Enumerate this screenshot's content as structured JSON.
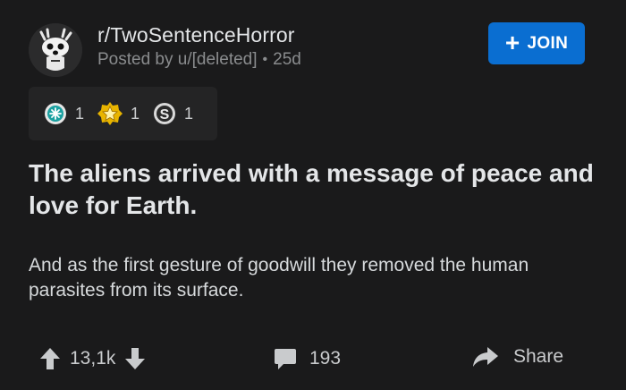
{
  "header": {
    "subreddit": "r/TwoSentenceHorror",
    "posted_by": "Posted by u/[deleted]",
    "separator": "•",
    "age": "25d",
    "join_label": "JOIN",
    "join_icon": "plus-icon"
  },
  "awards": [
    {
      "icon": "helpful-award-icon",
      "count": "1"
    },
    {
      "icon": "gold-star-award-icon",
      "count": "1"
    },
    {
      "icon": "silver-award-icon",
      "count": "1"
    }
  ],
  "post": {
    "title": "The aliens arrived with a message of peace and love for Earth.",
    "body": "And as the first gesture of goodwill they removed the human parasites from its surface."
  },
  "footer": {
    "score": "13,1k",
    "comments": "193",
    "share_label": "Share"
  },
  "colors": {
    "background": "#1a1a1b",
    "accent": "#0a6ed1",
    "award_panel": "#242425"
  }
}
